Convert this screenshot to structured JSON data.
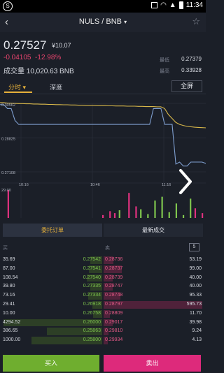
{
  "status_bar": {
    "time": "11:34"
  },
  "header": {
    "title": "NULS / BNB"
  },
  "summary": {
    "price": "0.27527",
    "cny": "¥10.07",
    "change_abs": "-0.04105",
    "change_pct": "-12.98%",
    "volume_label": "成交量",
    "volume_value": "10,020.63 BNB",
    "high_label": "最低",
    "high_value": "0.27379",
    "low_label": "最高",
    "low_value": "0.33928"
  },
  "tabs": {
    "time": "分时",
    "depth": "深度",
    "fullscreen": "全屏"
  },
  "chart_data": {
    "type": "line",
    "y_ticks": [
      "0.30562",
      "0.28825",
      "0.27108"
    ],
    "x_ticks": [
      "10:16",
      "10:46",
      "11:16"
    ],
    "volume_tick": "29.00",
    "series": [
      {
        "name": "price",
        "color": "#7f9fd0",
        "values": [
          0.305,
          0.305,
          0.303,
          0.303,
          0.297,
          0.295,
          0.295,
          0.295,
          0.295,
          0.295,
          0.295,
          0.295,
          0.295,
          0.295,
          0.295,
          0.295,
          0.295,
          0.295,
          0.295,
          0.295,
          0.295,
          0.295,
          0.295,
          0.295,
          0.295,
          0.295,
          0.295,
          0.295,
          0.295,
          0.295,
          0.295,
          0.295,
          0.295,
          0.295,
          0.295,
          0.295,
          0.295,
          0.295,
          0.295,
          0.295,
          0.295,
          0.303,
          0.303,
          0.303,
          0.295,
          0.295,
          0.295,
          0.275,
          0.276,
          0.274,
          0.274,
          0.276,
          0.276,
          0.276,
          0.276,
          0.2753
        ]
      },
      {
        "name": "average",
        "color": "#d9b84a",
        "values": [
          0.306,
          0.306,
          0.3058,
          0.3057,
          0.3056,
          0.3055,
          0.3055,
          0.3054,
          0.3054,
          0.3053,
          0.3053,
          0.3052,
          0.3052,
          0.3051,
          0.3051,
          0.305,
          0.305,
          0.3049,
          0.3049,
          0.3048,
          0.3048,
          0.3047,
          0.3047,
          0.3046,
          0.3046,
          0.3046,
          0.3045,
          0.3045,
          0.3045,
          0.3044,
          0.3044,
          0.3043,
          0.3043,
          0.3043,
          0.3042,
          0.3042,
          0.3042,
          0.3041,
          0.3041,
          0.304,
          0.304,
          0.304,
          0.3039,
          0.3039,
          0.303,
          0.3,
          0.298,
          0.296,
          0.295,
          0.2945,
          0.294,
          0.2938,
          0.2936,
          0.2935,
          0.2934,
          0.2933
        ]
      }
    ],
    "volume_values": [
      0,
      0,
      29,
      0,
      0,
      0,
      0,
      0,
      0,
      0,
      0,
      0,
      0,
      0,
      0,
      0,
      0,
      0,
      0,
      0,
      0,
      0,
      0,
      0,
      0,
      0,
      0,
      0,
      0,
      0,
      0,
      0,
      0,
      0,
      0,
      0,
      0,
      0,
      0,
      0,
      0,
      0,
      3,
      0,
      0,
      7,
      0,
      5,
      0,
      8,
      0,
      0,
      0,
      26,
      0,
      0,
      12,
      0,
      9,
      0,
      0,
      4,
      0,
      0,
      18,
      0,
      0,
      22,
      0,
      0,
      6,
      0,
      0,
      15,
      0,
      0,
      3,
      0,
      0,
      20,
      0,
      10,
      0,
      0,
      5
    ]
  },
  "order_tabs": {
    "active": "委托订单",
    "other": "最新成交"
  },
  "orderbook": {
    "buy_label": "买",
    "sell_label": "卖",
    "depth": "5",
    "rows": [
      {
        "bid_amt": "35.69",
        "bid_price": "0.27542",
        "ask_price": "0.28736",
        "ask_amt": "53.19",
        "bid_w": 0.12,
        "ask_w": 0.1
      },
      {
        "bid_amt": "87.00",
        "bid_price": "0.27541",
        "ask_price": "0.28737",
        "ask_amt": "99.00",
        "bid_w": 0.13,
        "ask_w": 0.18
      },
      {
        "bid_amt": "108.54",
        "bid_price": "0.27540",
        "ask_price": "0.28739",
        "ask_amt": "40.00",
        "bid_w": 0.15,
        "ask_w": 0.09
      },
      {
        "bid_amt": "39.80",
        "bid_price": "0.27335",
        "ask_price": "0.28747",
        "ask_amt": "40.00",
        "bid_w": 0.12,
        "ask_w": 0.09
      },
      {
        "bid_amt": "73.16",
        "bid_price": "0.27334",
        "ask_price": "0.28748",
        "ask_amt": "95.33",
        "bid_w": 0.14,
        "ask_w": 0.17
      },
      {
        "bid_amt": "29.41",
        "bid_price": "0.26918",
        "ask_price": "0.28797",
        "ask_amt": "595.73",
        "bid_w": 0.1,
        "ask_w": 0.98
      },
      {
        "bid_amt": "10.00",
        "bid_price": "0.26758",
        "ask_price": "0.28809",
        "ask_amt": "11.70",
        "bid_w": 0.09,
        "ask_w": 0.06
      },
      {
        "bid_amt": "4294.52",
        "bid_price": "0.26000",
        "ask_price": "0.29017",
        "ask_amt": "39.98",
        "bid_w": 0.98,
        "ask_w": 0.09
      },
      {
        "bid_amt": "386.65",
        "bid_price": "0.25863",
        "ask_price": "0.29810",
        "ask_amt": "9.24",
        "bid_w": 0.55,
        "ask_w": 0.05
      },
      {
        "bid_amt": "1000.00",
        "bid_price": "0.25800",
        "ask_price": "0.29934",
        "ask_amt": "4.13",
        "bid_w": 0.7,
        "ask_w": 0.04
      }
    ]
  },
  "actions": {
    "buy": "买入",
    "sell": "卖出"
  },
  "colors": {
    "up": "#7fc54e",
    "down": "#e25a86",
    "accent": "#e7b13a",
    "buy_button": "#6fae2f",
    "sell_button": "#dd2a7b"
  }
}
